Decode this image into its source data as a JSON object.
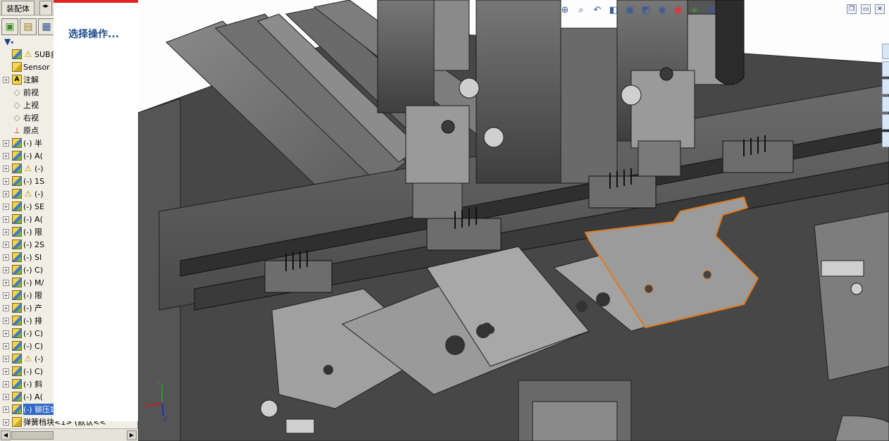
{
  "panel": {
    "tabs": [
      {
        "label": "装配体"
      }
    ],
    "filter_icon": "funnel-icon",
    "toolbar_icons": [
      "feature-manager-icon",
      "property-manager-icon",
      "configuration-manager-icon"
    ]
  },
  "property_manager": {
    "message": "选择操作..."
  },
  "tree": {
    "items": [
      {
        "label": "SUB自动",
        "icon": "assembly-icon",
        "warn": true,
        "expander": false
      },
      {
        "label": "Sensor",
        "icon": "sensor-icon",
        "warn": false,
        "expander": false
      },
      {
        "label": "注解",
        "icon": "annotation-icon",
        "warn": false,
        "expander": true
      },
      {
        "label": "前视",
        "icon": "plane-icon",
        "warn": false,
        "expander": false
      },
      {
        "label": "上视",
        "icon": "plane-icon",
        "warn": false,
        "expander": false
      },
      {
        "label": "右视",
        "icon": "plane-icon",
        "warn": false,
        "expander": false
      },
      {
        "label": "原点",
        "icon": "origin-icon",
        "warn": false,
        "expander": false
      },
      {
        "label": "(-) 半",
        "icon": "component-icon",
        "warn": false,
        "expander": true
      },
      {
        "label": "(-) A(",
        "icon": "component-icon",
        "warn": false,
        "expander": true
      },
      {
        "label": "(-)",
        "icon": "component-icon",
        "warn": true,
        "expander": true
      },
      {
        "label": "(-) 1S",
        "icon": "component-icon",
        "warn": false,
        "expander": true
      },
      {
        "label": "(-)",
        "icon": "component-icon",
        "warn": true,
        "expander": true
      },
      {
        "label": "(-) SE",
        "icon": "component-icon",
        "warn": false,
        "expander": true
      },
      {
        "label": "(-) A(",
        "icon": "component-icon",
        "warn": false,
        "expander": true
      },
      {
        "label": "(-) 限",
        "icon": "component-icon",
        "warn": false,
        "expander": true
      },
      {
        "label": "(-) 2S",
        "icon": "component-icon",
        "warn": false,
        "expander": true
      },
      {
        "label": "(-) SI",
        "icon": "component-icon",
        "warn": false,
        "expander": true
      },
      {
        "label": "(-) C)",
        "icon": "component-icon",
        "warn": false,
        "expander": true
      },
      {
        "label": "(-) M/",
        "icon": "component-icon",
        "warn": false,
        "expander": true
      },
      {
        "label": "(-) 限",
        "icon": "component-icon",
        "warn": false,
        "expander": true
      },
      {
        "label": "(-) 产",
        "icon": "component-icon",
        "warn": false,
        "expander": true
      },
      {
        "label": "(-) 排",
        "icon": "component-icon",
        "warn": false,
        "expander": true
      },
      {
        "label": "(-) C)",
        "icon": "component-icon",
        "warn": false,
        "expander": true
      },
      {
        "label": "(-) C)",
        "icon": "component-icon",
        "warn": false,
        "expander": true
      },
      {
        "label": "(-)",
        "icon": "component-icon",
        "warn": true,
        "expander": true
      },
      {
        "label": "(-) C)",
        "icon": "component-icon",
        "warn": false,
        "expander": true
      },
      {
        "label": "(-) 斜",
        "icon": "component-icon",
        "warn": false,
        "expander": true
      },
      {
        "label": "(-) A(",
        "icon": "component-icon",
        "warn": false,
        "expander": true
      },
      {
        "label": "(-) 铆压站拔抓<1> (默认",
        "icon": "component-icon",
        "warn": false,
        "expander": true,
        "selected": true
      },
      {
        "label": "弹簧档块<1> (默认<<",
        "icon": "part-icon",
        "warn": false,
        "expander": true
      }
    ]
  },
  "graphics": {
    "hud_icons": [
      "zoom-fit-icon",
      "zoom-area-icon",
      "previous-view-icon",
      "section-view-icon",
      "view-orientation-icon",
      "display-style-icon",
      "hide-show-icon",
      "appearance-icon",
      "scene-icon",
      "view-settings-icon"
    ],
    "window_controls": [
      "restore-icon",
      "minimize-icon",
      "close-icon"
    ],
    "triad": {
      "x": "X",
      "y": "Y",
      "z": "Z"
    },
    "colors": {
      "body": "#5d5d5d",
      "highlight": "#e07a1f",
      "selection": "#3167c6"
    }
  }
}
